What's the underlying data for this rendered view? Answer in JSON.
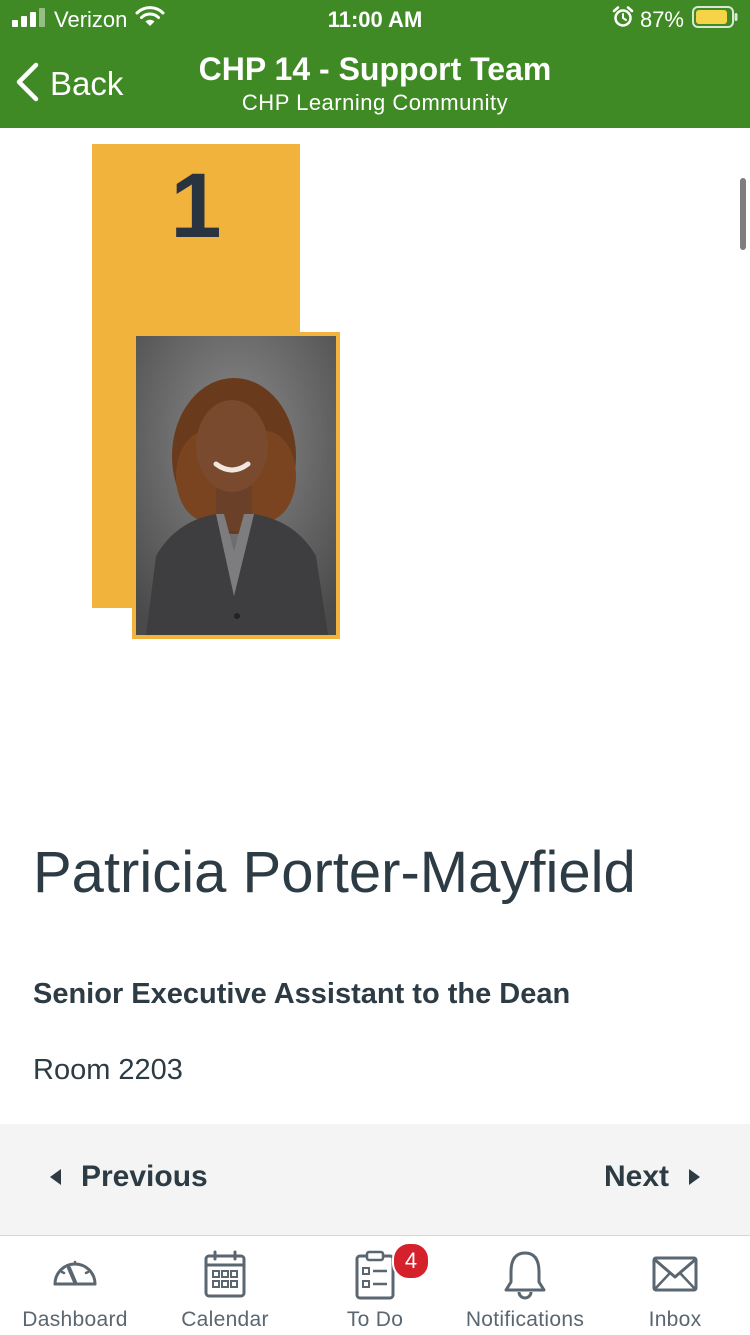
{
  "status_bar": {
    "carrier": "Verizon",
    "time": "11:00 AM",
    "battery_percent": "87%",
    "icons": [
      "signal-icon",
      "wifi-icon",
      "alarm-icon",
      "battery-icon"
    ]
  },
  "nav": {
    "back_label": "Back",
    "title": "CHP 14 - Support Team",
    "subtitle": "CHP Learning Community"
  },
  "profile": {
    "rank": "1",
    "name": "Patricia Porter-Mayfield",
    "title": "Senior Executive Assistant to the Dean",
    "room": "Room 2203"
  },
  "pager": {
    "previous_label": "Previous",
    "next_label": "Next"
  },
  "tabbar": {
    "items": [
      {
        "label": "Dashboard",
        "icon": "dashboard-icon"
      },
      {
        "label": "Calendar",
        "icon": "calendar-icon"
      },
      {
        "label": "To Do",
        "icon": "todo-icon",
        "badge": "4"
      },
      {
        "label": "Notifications",
        "icon": "bell-icon"
      },
      {
        "label": "Inbox",
        "icon": "inbox-icon"
      }
    ]
  },
  "colors": {
    "header_green": "#3f8a25",
    "accent_gold": "#f2b33d",
    "text_dark": "#2d3b45",
    "badge_red": "#d4212b"
  }
}
